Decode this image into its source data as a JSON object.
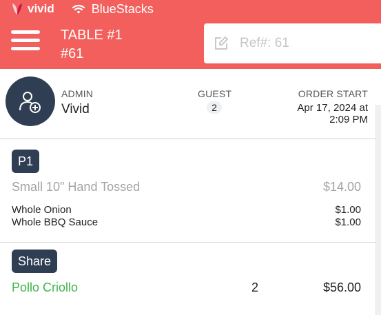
{
  "status_bar": {
    "brand": "vivid",
    "carrier": "BlueStacks"
  },
  "header": {
    "title_line1": "TABLE #1",
    "title_line2": "#61"
  },
  "ref_field": {
    "placeholder": "Ref#: 61",
    "value": ""
  },
  "order_info": {
    "admin_label": "ADMIN",
    "admin_name": "Vivid",
    "guest_label": "GUEST",
    "guest_count": "2",
    "order_start_label": "ORDER START",
    "order_start_date": "Apr 17, 2024 at",
    "order_start_time": "2:09 PM"
  },
  "items": [
    {
      "tag": "P1",
      "name": "Small 10\" Hand Tossed",
      "price": "$14.00",
      "modifiers": [
        {
          "name": "Whole Onion",
          "price": "$1.00"
        },
        {
          "name": "Whole BBQ Sauce",
          "price": "$1.00"
        }
      ]
    },
    {
      "tag": "Share",
      "name": "Pollo Criollo",
      "qty": "2",
      "price": "$56.00"
    }
  ],
  "colors": {
    "header": "#f25f5c",
    "dark_navy": "#2f3e53",
    "green": "#3cb64a",
    "muted": "#a3a3a3"
  }
}
